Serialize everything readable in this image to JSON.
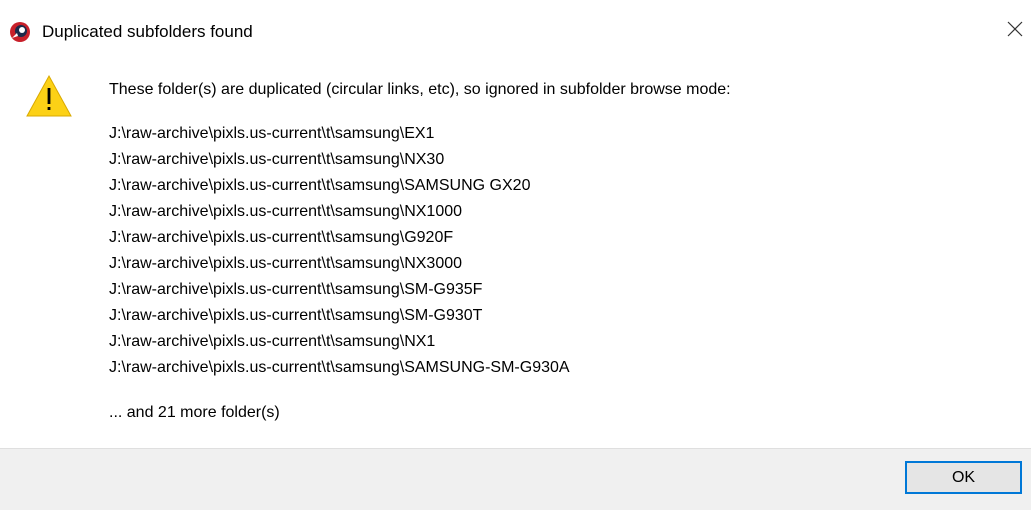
{
  "window": {
    "title": "Duplicated subfolders found",
    "app_icon": "app-logo-icon",
    "close_icon": "close-icon"
  },
  "content": {
    "warning_icon": "warning-icon",
    "message": "These folder(s) are duplicated (circular links, etc), so ignored in subfolder browse mode:",
    "folders": [
      "J:\\raw-archive\\pixls.us-current\\t\\samsung\\EX1",
      "J:\\raw-archive\\pixls.us-current\\t\\samsung\\NX30",
      "J:\\raw-archive\\pixls.us-current\\t\\samsung\\SAMSUNG GX20",
      "J:\\raw-archive\\pixls.us-current\\t\\samsung\\NX1000",
      "J:\\raw-archive\\pixls.us-current\\t\\samsung\\G920F",
      "J:\\raw-archive\\pixls.us-current\\t\\samsung\\NX3000",
      "J:\\raw-archive\\pixls.us-current\\t\\samsung\\SM-G935F",
      "J:\\raw-archive\\pixls.us-current\\t\\samsung\\SM-G930T",
      "J:\\raw-archive\\pixls.us-current\\t\\samsung\\NX1",
      "J:\\raw-archive\\pixls.us-current\\t\\samsung\\SAMSUNG-SM-G930A"
    ],
    "more_text": "... and 21 more folder(s)"
  },
  "footer": {
    "ok_label": "OK"
  },
  "colors": {
    "accent": "#0078d7",
    "footer_bg": "#f0f0f0",
    "warning_yellow": "#fcd116"
  }
}
